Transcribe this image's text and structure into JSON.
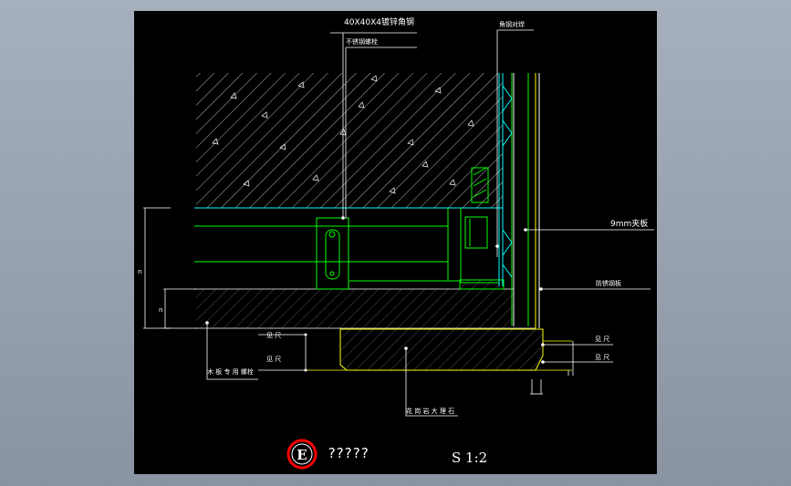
{
  "colors": {
    "background": "#000000",
    "window_backdrop": "#9aa4b1",
    "leader": "#ffffff",
    "concrete_hatch": "#ffffff",
    "steel": "#00ff00",
    "stone": "#ffff00",
    "panel": "#00ffff",
    "marker_ring": "#ff0000"
  },
  "labels": {
    "angle_steel": "40X40X4镀锌角钢",
    "stainless_bolt": "不锈钢螺栓",
    "steel_weld": "角钢对焊",
    "plywood_9mm": "9mm夹板",
    "stainless_plate": "防锈钢板",
    "dim_right_top": "见  尺",
    "dim_right_bottom": "见  尺",
    "dim_left_top": "见  尺",
    "dim_left_bottom": "见  尺",
    "left_note": "木 板 专 用 螺栓",
    "marble": "花 岗 岩 大 理 石",
    "dim_vertical_long": "n",
    "dim_vertical_short": "n"
  },
  "title": {
    "marker_letter": "E",
    "name": "?????",
    "scale": "S 1:2"
  }
}
